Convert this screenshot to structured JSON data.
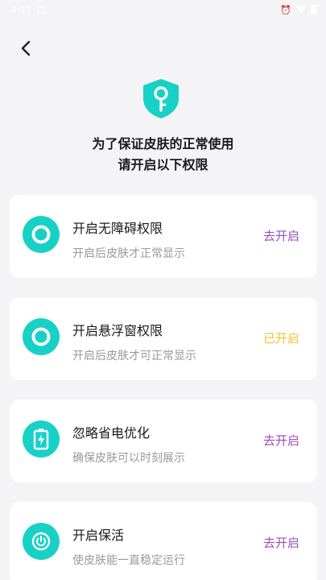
{
  "status_bar": {
    "time": "4:17"
  },
  "header": {
    "line1": "为了保证皮肤的正常使用",
    "line2": "请开启以下权限"
  },
  "permissions": [
    {
      "title": "开启无障碍权限",
      "subtitle": "开启后皮肤才正常显示",
      "action": "去开启",
      "icon": "ring-icon"
    },
    {
      "title": "开启悬浮窗权限",
      "subtitle": "开启后皮肤才可正常显示",
      "action": "已开启",
      "icon": "ring-icon"
    },
    {
      "title": "忽略省电优化",
      "subtitle": "确保皮肤可以时刻展示",
      "action": "去开启",
      "icon": "battery-icon"
    },
    {
      "title": "开启保活",
      "subtitle": "使皮肤能一直稳定运行",
      "action": "去开启",
      "icon": "power-icon"
    }
  ],
  "colors": {
    "accent": "#17d1c6",
    "action_pending": "#9b4fb5",
    "action_done": "#f2c230",
    "background": "#f4f4f6"
  }
}
